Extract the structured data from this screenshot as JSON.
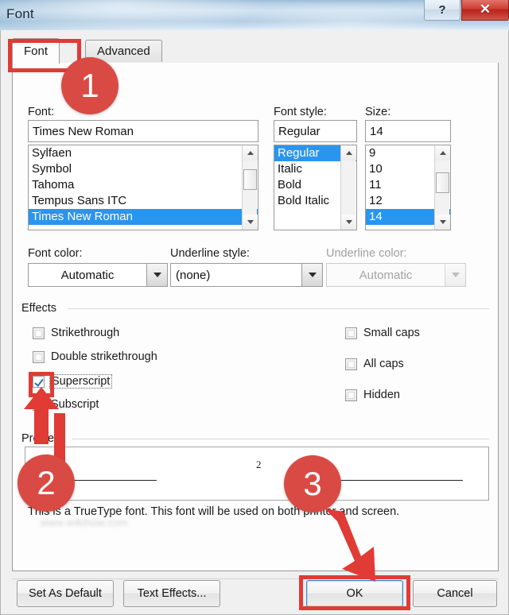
{
  "window": {
    "title": "Font",
    "help_button": "?",
    "close_button": "✕"
  },
  "tabs": [
    {
      "label": "Font",
      "active": true
    },
    {
      "label": "Advanced",
      "active": false
    }
  ],
  "font_section": {
    "font_label": "Font:",
    "font_value": "Times New Roman",
    "font_list": [
      "Sylfaen",
      "Symbol",
      "Tahoma",
      "Tempus Sans ITC",
      "Times New Roman"
    ],
    "font_selected": "Times New Roman",
    "style_label": "Font style:",
    "style_value": "Regular",
    "style_list": [
      "Regular",
      "Italic",
      "Bold",
      "Bold Italic"
    ],
    "style_selected": "Regular",
    "size_label": "Size:",
    "size_value": "14",
    "size_list": [
      "9",
      "10",
      "11",
      "12",
      "14"
    ],
    "size_selected": "14"
  },
  "color_row": {
    "font_color_label": "Font color:",
    "font_color_value": "Automatic",
    "underline_style_label": "Underline style:",
    "underline_style_value": "(none)",
    "underline_color_label": "Underline color:",
    "underline_color_value": "Automatic"
  },
  "effects": {
    "group_label": "Effects",
    "left": [
      {
        "label": "Strikethrough",
        "checked": false
      },
      {
        "label": "Double strikethrough",
        "checked": false
      },
      {
        "label": "Superscript",
        "checked": true
      },
      {
        "label": "Subscript",
        "checked": false
      }
    ],
    "right": [
      {
        "label": "Small caps",
        "checked": false
      },
      {
        "label": "All caps",
        "checked": false
      },
      {
        "label": "Hidden",
        "checked": false
      }
    ]
  },
  "preview": {
    "group_label": "Preview",
    "sample_text": "2",
    "truetype_note": "This is a TrueType font. This font will be used on both printer and screen.",
    "watermark": "www.wikihow.com"
  },
  "footer": {
    "set_as_default": "Set As Default",
    "text_effects": "Text Effects...",
    "ok": "OK",
    "cancel": "Cancel"
  },
  "annotations": {
    "badges": [
      "1",
      "2",
      "3"
    ],
    "accent_color": "#da4a44",
    "highlight_color": "#e03b35"
  }
}
